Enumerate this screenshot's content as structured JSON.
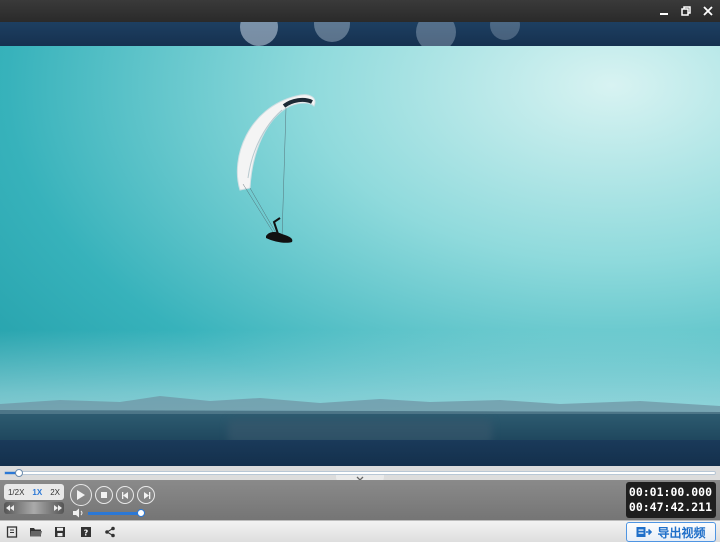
{
  "window": {
    "minimize_icon": "minimize-icon",
    "restore_icon": "restore-icon",
    "close_icon": "close-icon"
  },
  "player": {
    "speed_options": [
      "1/2X",
      "1X",
      "2X"
    ],
    "speed_selected": "1X",
    "progress_fraction": 0.02,
    "volume_fraction": 0.95,
    "current_time": "00:01:00.000",
    "total_time": "00:47:42.211"
  },
  "toolbar": {
    "icons": [
      "new-project-icon",
      "open-folder-icon",
      "save-icon",
      "help-icon",
      "share-icon"
    ],
    "export_label": "导出视频",
    "export_icon": "export-video-icon"
  },
  "colors": {
    "accent": "#2b78d6",
    "controlbar": "#7d7d7d",
    "timebox": "#1e1e1e"
  }
}
